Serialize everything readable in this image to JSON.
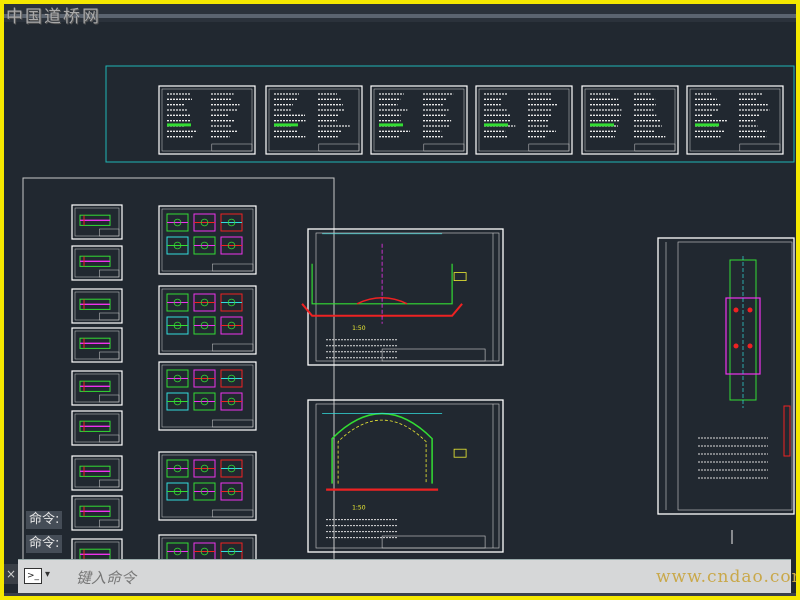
{
  "watermark_top": "中国道桥网",
  "watermark_bottom": "www.cndao.com",
  "command_history": [
    "命令:",
    "命令:"
  ],
  "command_line": {
    "placeholder": "键入命令",
    "prompt_icon": "terminal-icon",
    "close_icon": "close-icon"
  },
  "drawing_scales": [
    "1:50",
    "1:50"
  ],
  "colors": {
    "background": "#212830",
    "frame_border": "#f5e800",
    "sheet_border": "#ffffff",
    "selection_box": "#1fb6b6",
    "viewport_box": "#c8c8c8",
    "line_green": "#33dd33",
    "line_red": "#ee2222",
    "line_magenta": "#ee33ee",
    "line_cyan": "#33dddd",
    "line_yellow": "#eeee33"
  }
}
